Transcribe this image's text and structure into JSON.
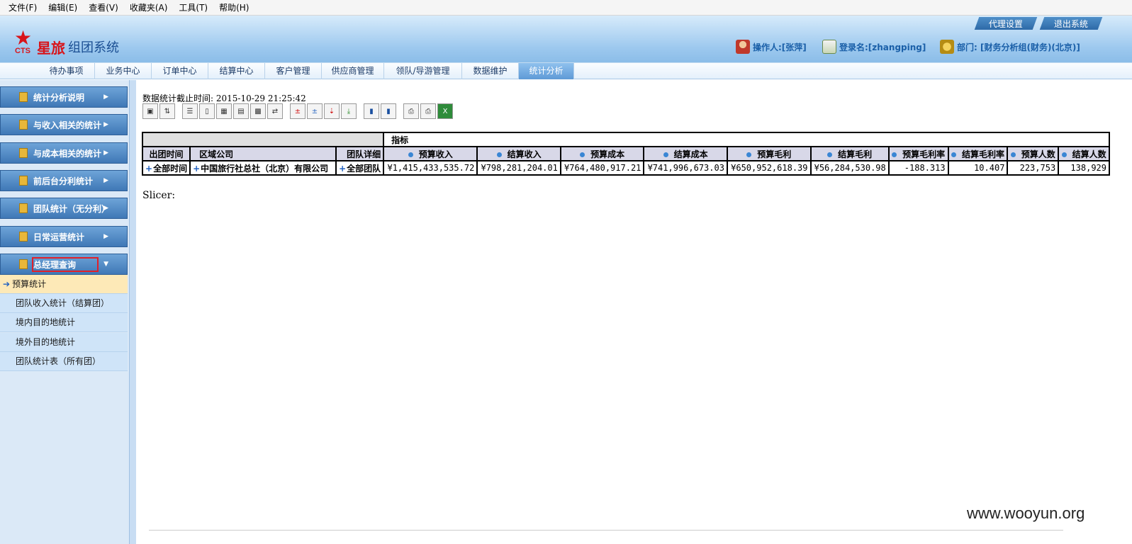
{
  "menu": [
    "文件(F)",
    "编辑(E)",
    "查看(V)",
    "收藏夹(A)",
    "工具(T)",
    "帮助(H)"
  ],
  "header": {
    "logo_mark": "★",
    "logo_cts": "CTS",
    "logo_brand": "星旅",
    "logo_system": "组团系统",
    "btn_proxy": "代理设置",
    "btn_logout": "退出系统",
    "operator": "操作人:[张萍]",
    "login": "登录名:[zhangping]",
    "dept": "部门: [财务分析组(财务)(北京)]"
  },
  "nav": [
    "待办事项",
    "业务中心",
    "订单中心",
    "结算中心",
    "客户管理",
    "供应商管理",
    "领队/导游管理",
    "数据维护",
    "统计分析"
  ],
  "sidebar": {
    "groups": [
      "统计分析说明",
      "与收入相关的统计",
      "与成本相关的统计",
      "前后台分利统计",
      "团队统计（无分利）",
      "日常运营统计",
      "总经理查询"
    ],
    "subitems": [
      "预算统计",
      "团队收入统计（结算团）",
      "境内目的地统计",
      "境外目的地统计",
      "团队统计表（所有团）"
    ]
  },
  "content": {
    "stamp": "数据统计截止时间: 2015-10-29 21:25:42",
    "slicer": "Slicer:",
    "watermark": "www.wooyun.org"
  },
  "table": {
    "measure_header": "指标",
    "row_headers": [
      "出团时间",
      "区域公司",
      "团队详细"
    ],
    "columns": [
      "预算收入",
      "结算收入",
      "预算成本",
      "结算成本",
      "预算毛利",
      "结算毛利",
      "预算毛利率",
      "结算毛利率",
      "预算人数",
      "结算人数"
    ],
    "row_labels": [
      "全部时间",
      "中国旅行社总社（北京）有限公司",
      "全部团队"
    ],
    "values": [
      "¥1,415,433,535.72",
      "¥798,281,204.01",
      "¥764,480,917.21",
      "¥741,996,673.03",
      "¥650,952,618.39",
      "¥56,284,530.98",
      "-188.313",
      "10.407",
      "223,753",
      "138,929"
    ]
  }
}
